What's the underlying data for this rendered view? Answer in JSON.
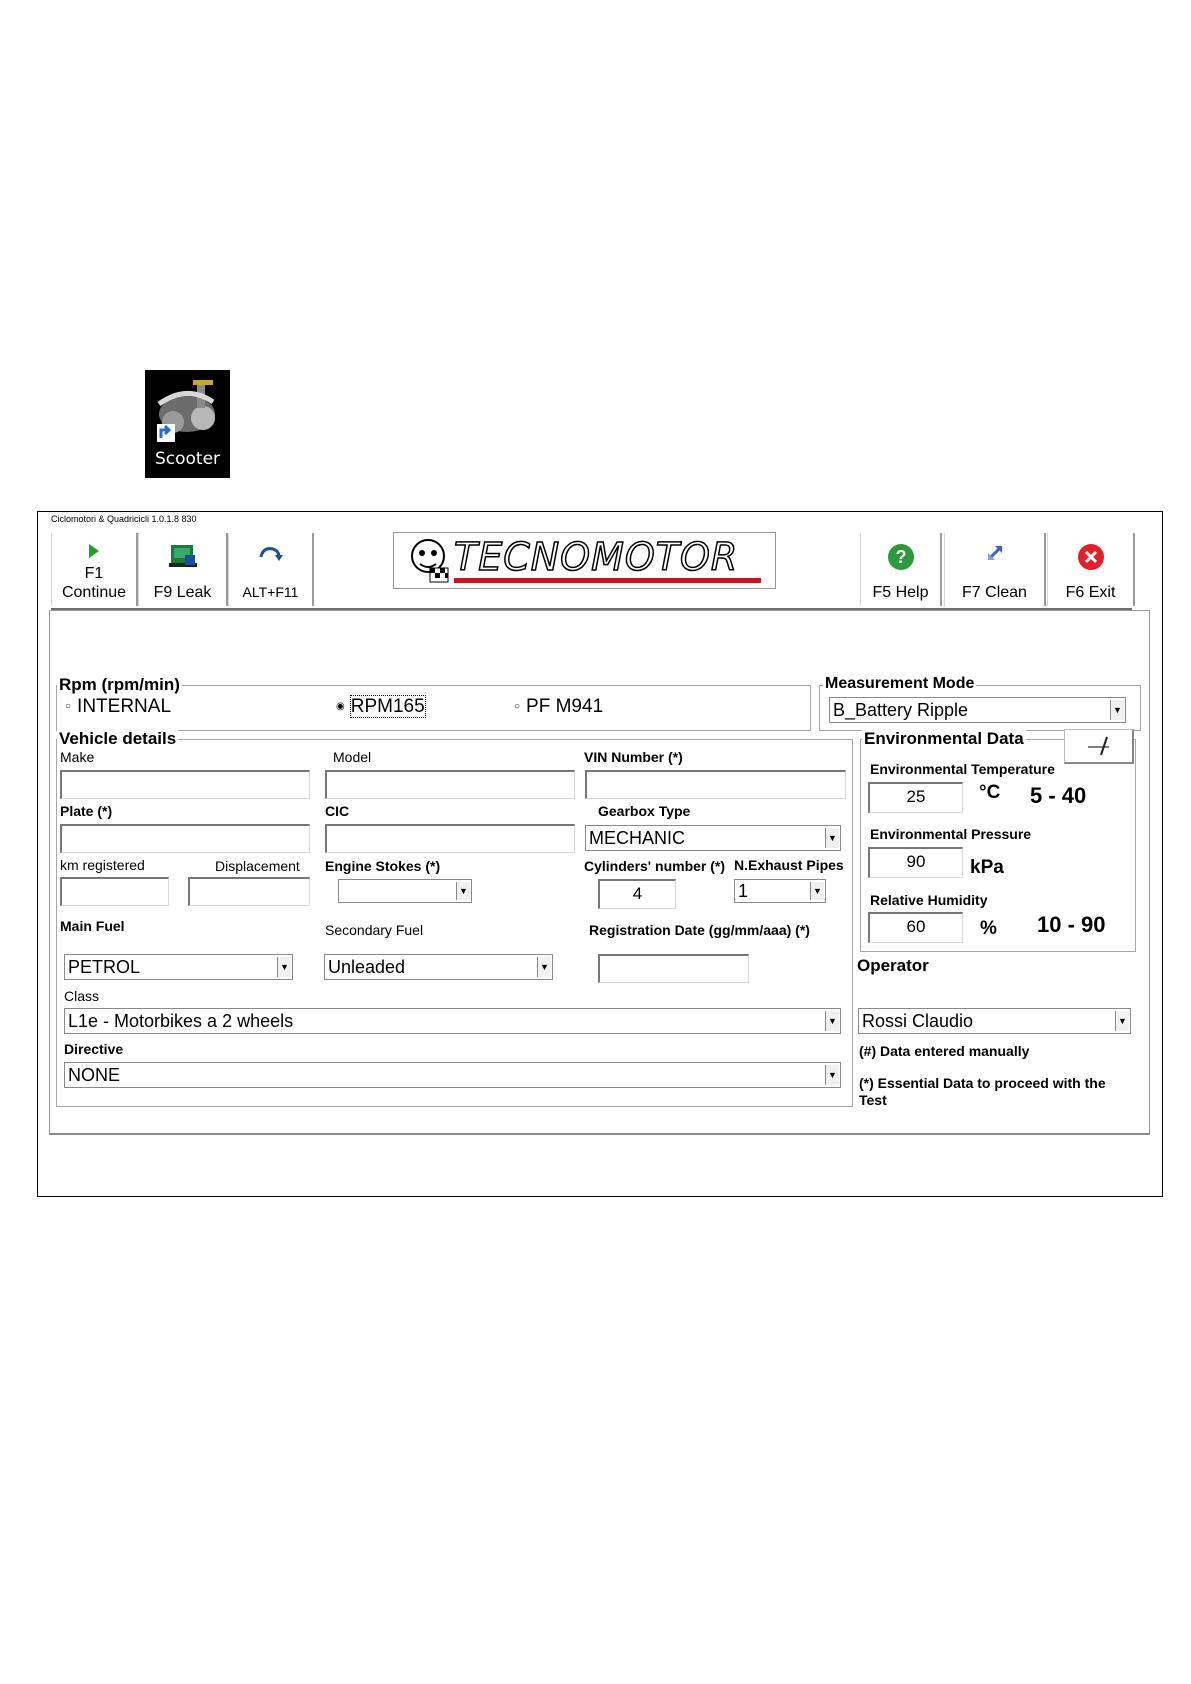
{
  "desktop": {
    "shortcut_label": "Scooter"
  },
  "window": {
    "title": "Ciclomotori & Quadricicli 1.0.1.8 830"
  },
  "toolbar": {
    "continue_label_1": "F1",
    "continue_label_2": "Continue",
    "leak_label": "F9 Leak",
    "alt_label": "ALT+F11",
    "help_label": "F5 Help",
    "clean_label": "F7 Clean",
    "exit_label": "F6 Exit",
    "logo_text": "TECNOMOTOR"
  },
  "rpm": {
    "legend": "Rpm (rpm/min)",
    "options": [
      "INTERNAL",
      "RPM165",
      "PF M941"
    ],
    "selected": "RPM165"
  },
  "measurement": {
    "legend": "Measurement Mode",
    "value": "B_Battery Ripple"
  },
  "vehicle": {
    "legend": "Vehicle details",
    "make_label": "Make",
    "model_label": "Model",
    "vin_label": "VIN Number (*)",
    "plate_label": "Plate (*)",
    "cic_label": "CIC",
    "gearbox_label": "Gearbox Type",
    "gearbox_value": "MECHANIC",
    "km_label": "km registered",
    "displacement_label": "Displacement",
    "engine_label": "Engine Stokes (*)",
    "cylinders_label": "Cylinders' number (*)",
    "cylinders_value": "4",
    "exhaust_label": "N.Exhaust Pipes",
    "exhaust_value": "1",
    "main_fuel_label": "Main Fuel",
    "main_fuel_value": "PETROL",
    "secondary_fuel_label": "Secondary Fuel",
    "secondary_fuel_value": "Unleaded",
    "regdate_label": "Registration Date (gg/mm/aaa) (*)",
    "class_label": "Class",
    "class_value": "L1e - Motorbikes a 2 wheels",
    "directive_label": "Directive",
    "directive_value": "NONE"
  },
  "environment": {
    "legend": "Environmental Data",
    "temp_label": "Environmental Temperature",
    "temp_value": "25",
    "temp_unit": "°C",
    "temp_range": "5 - 40",
    "pressure_label": "Environmental Pressure",
    "pressure_value": "90",
    "pressure_unit": "kPa",
    "humidity_label": "Relative Humidity",
    "humidity_value": "60",
    "humidity_unit": "%",
    "humidity_range": "10 - 90"
  },
  "operator": {
    "label": "Operator",
    "value": "Rossi Claudio",
    "note_manual": "(#) Data entered manually",
    "note_essential": "(*) Essential Data to proceed with the Test"
  },
  "icons": [
    "continue-play-icon",
    "leak-test-icon",
    "redo-arrow-icon",
    "help-icon",
    "clean-arrows-icon",
    "exit-icon",
    "pen-edit-icon",
    "tecnomotor-logo-icon"
  ]
}
